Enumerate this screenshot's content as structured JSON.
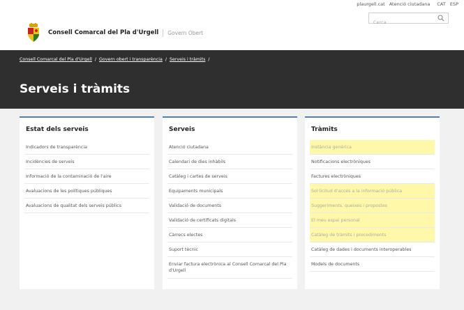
{
  "top_links": {
    "site": "plaurgell.cat",
    "atencio": "Atenció ciutadana",
    "lang_cat": "CAT",
    "lang_esp": "ESP"
  },
  "search": {
    "placeholder": "Cerca"
  },
  "brand": {
    "name": "Consell Comarcal del Pla d'Urgell",
    "subtitle": "Govern Obert"
  },
  "breadcrumb": {
    "items": [
      "Consell Comarcal del Pla d'Urgell",
      "Govern obert i transparència",
      "Serveis i tràmits"
    ],
    "separator": "/"
  },
  "page_title": "Serveis i tràmits",
  "columns": [
    {
      "title": "Estat dels serveis",
      "items": [
        "Indicadors de transparència",
        "Incidències de serveis",
        "Informació de la contaminació de l'aire",
        "Avaluacions de les polítiques públiques",
        "Avaluacions de qualitat dels serveis públics"
      ]
    },
    {
      "title": "Serveis",
      "items": [
        "Atenció ciutadana",
        "Calendari de dies inhàbils",
        "Catàleg i cartes de serveis",
        "Equipaments municipals",
        "Validació de documents",
        "Validació de certificats digitals",
        "Càrrecs electes",
        "Suport tècnic",
        "Enviar factura electrònica al Consell Comarcal del Pla d'Urgell"
      ]
    },
    {
      "title": "Tràmits",
      "items": [
        "Instància genèrica",
        "Notificacions electròniques",
        "Factures electròniques",
        "Sol·licitud d'accés a la informació pública",
        "Suggeriments, queixes i propostes",
        "El meu espai personal",
        "Catàleg de tràmits i procediments",
        "Catàleg de dades i documents interoperables",
        "Models de documents"
      ]
    }
  ],
  "colors": {
    "hero_bg": "#2f2f2f",
    "accent_blue": "#4a7fc1",
    "highlight": "#fff8a8"
  }
}
